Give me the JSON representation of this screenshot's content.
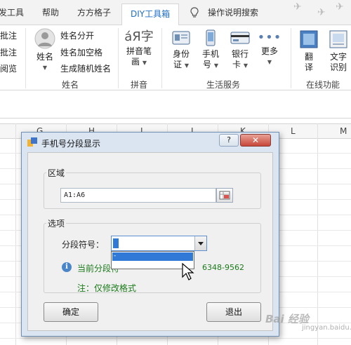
{
  "tabs": [
    {
      "label": "发工具"
    },
    {
      "label": "帮助"
    },
    {
      "label": "方方格子"
    },
    {
      "label": "DIY工具箱"
    },
    {
      "label": "操作说明搜索"
    }
  ],
  "ribbon": {
    "left_items": [
      "批注",
      "批注",
      "阅览"
    ],
    "name_group": {
      "button": "姓名",
      "items": [
        "姓名分开",
        "姓名加空格",
        "生成随机姓名"
      ],
      "label": "姓名"
    },
    "pinyin_group": {
      "button_line1": "拼音笔",
      "button_line2": "画",
      "label": "拼音",
      "icon_glyph": "áЯ字"
    },
    "life_group": {
      "buttons": [
        {
          "line1": "身份",
          "line2": "证"
        },
        {
          "line1": "手机",
          "line2": "号"
        },
        {
          "line1": "银行",
          "line2": "卡"
        },
        {
          "line1": "更多",
          "line2": ""
        }
      ],
      "label": "生活服务"
    },
    "online_group": {
      "buttons": [
        {
          "line1": "翻",
          "line2": "译"
        },
        {
          "line1": "文字",
          "line2": "识别"
        }
      ],
      "label": "在线功能"
    }
  },
  "columns": [
    "G",
    "H",
    "I",
    "J",
    "K",
    "L",
    "M"
  ],
  "dialog": {
    "title": "手机号分段显示",
    "help_label": "?",
    "close_label": "✕",
    "range_group_label": "区域",
    "range_value": "A1:A6",
    "options_group_label": "选项",
    "separator_label": "分段符号：",
    "separator_value": "-",
    "dropdown_options": [
      "-"
    ],
    "current_label": "当前分段符",
    "phone_sample": "6348-9562",
    "note": "注：仅修改格式",
    "ok_label": "确定",
    "exit_label": "退出"
  },
  "watermark": "Bai 经验",
  "watermark_sub": "jingyan.baidu.com",
  "colors": {
    "accent_blue": "#1e6ec8",
    "dialog_frame": "#dbe5f1",
    "close_red": "#c7473a",
    "note_green": "#1a7a1a",
    "selection_blue": "#3079d6"
  }
}
